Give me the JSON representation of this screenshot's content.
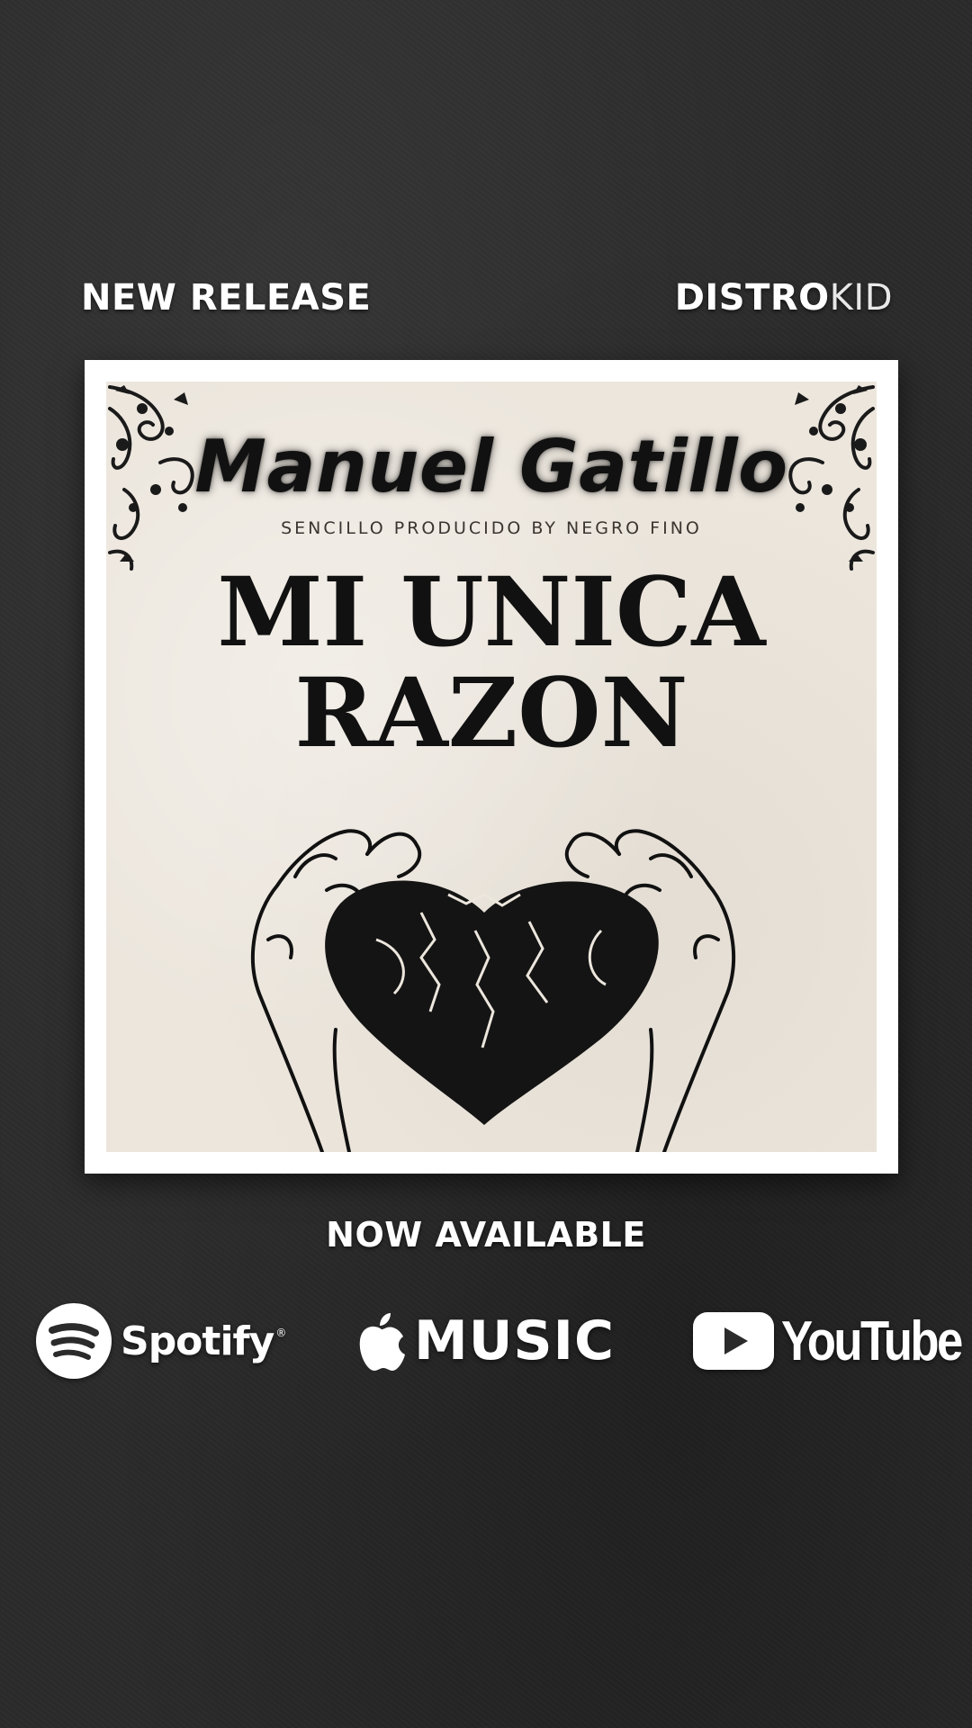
{
  "header": {
    "left_label": "NEW RELEASE",
    "brand_bold": "DISTRO",
    "brand_light": "KID"
  },
  "cover": {
    "artist": "Manuel Gatillo",
    "producer_line": "SENCILLO PRODUCIDO BY NEGRO FINO",
    "title_line1": "MI UNICA",
    "title_line2": "RAZON",
    "illustration": "heart-torn-by-hands"
  },
  "footer": {
    "cta": "NOW AVAILABLE"
  },
  "platforms": {
    "spotify": {
      "label": "Spotify",
      "mark": "®",
      "icon": "spotify-icon"
    },
    "apple": {
      "label": "MUSIC",
      "icon": "apple-icon"
    },
    "youtube": {
      "label": "YouTube",
      "icon": "youtube-play-icon"
    }
  },
  "colors": {
    "background": "#2b2b2b",
    "paper": "#ece6dd",
    "ink": "#111111",
    "text": "#ffffff"
  }
}
